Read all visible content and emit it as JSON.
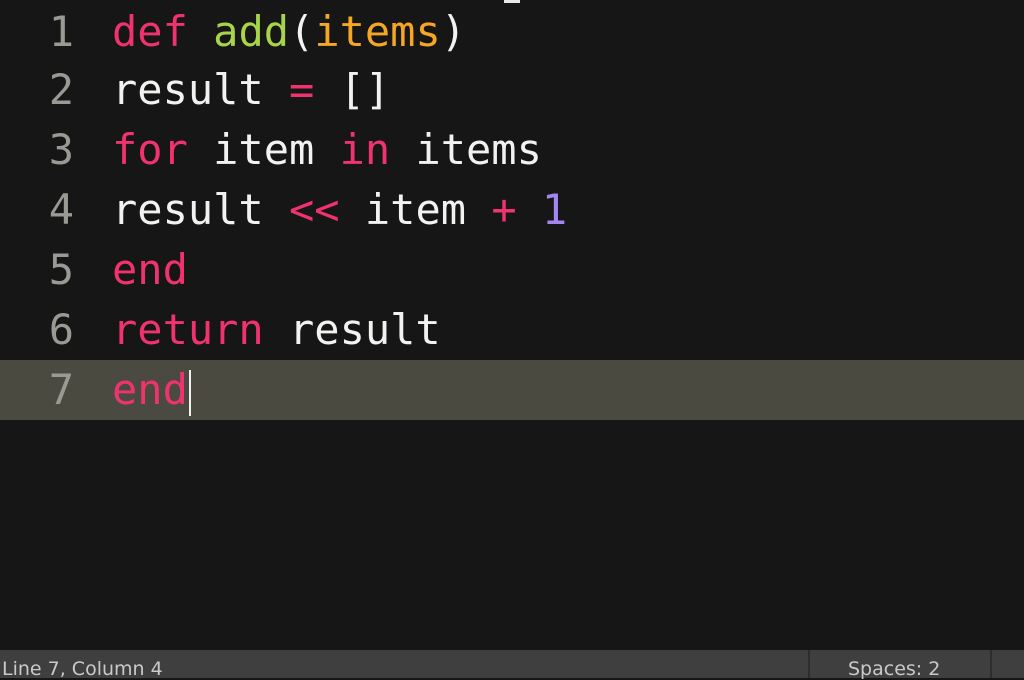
{
  "colors": {
    "background": "#161616",
    "current_line": "#4b4a40",
    "gutter": "#9a9a94",
    "plain": "#f2f2f0",
    "keyword": "#f0336f",
    "function": "#a8d44a",
    "parameter": "#f5a623",
    "number": "#a585f0",
    "statusbar": "#3f3f3f"
  },
  "editor": {
    "current_line_index": 6,
    "lines": [
      {
        "number": "1",
        "tokens": [
          {
            "text": "def",
            "kind": "keyword"
          },
          {
            "text": " ",
            "kind": "plain"
          },
          {
            "text": "add",
            "kind": "function"
          },
          {
            "text": "(",
            "kind": "plain"
          },
          {
            "text": "items",
            "kind": "parameter"
          },
          {
            "text": ")",
            "kind": "plain"
          }
        ]
      },
      {
        "number": "2",
        "tokens": [
          {
            "text": "result",
            "kind": "plain"
          },
          {
            "text": " ",
            "kind": "plain"
          },
          {
            "text": "=",
            "kind": "keyword"
          },
          {
            "text": " ",
            "kind": "plain"
          },
          {
            "text": "[]",
            "kind": "plain"
          }
        ]
      },
      {
        "number": "3",
        "tokens": [
          {
            "text": "for",
            "kind": "keyword"
          },
          {
            "text": " item ",
            "kind": "plain"
          },
          {
            "text": "in",
            "kind": "keyword"
          },
          {
            "text": " items",
            "kind": "plain"
          }
        ]
      },
      {
        "number": "4",
        "tokens": [
          {
            "text": "result",
            "kind": "plain"
          },
          {
            "text": " ",
            "kind": "plain"
          },
          {
            "text": "<<",
            "kind": "keyword"
          },
          {
            "text": " item ",
            "kind": "plain"
          },
          {
            "text": "+",
            "kind": "keyword"
          },
          {
            "text": " ",
            "kind": "plain"
          },
          {
            "text": "1",
            "kind": "number"
          }
        ]
      },
      {
        "number": "5",
        "tokens": [
          {
            "text": "end",
            "kind": "keyword"
          }
        ]
      },
      {
        "number": "6",
        "tokens": [
          {
            "text": "return",
            "kind": "keyword"
          },
          {
            "text": " result",
            "kind": "plain"
          }
        ]
      },
      {
        "number": "7",
        "tokens": [
          {
            "text": "end",
            "kind": "keyword"
          }
        ]
      }
    ]
  },
  "statusbar": {
    "cursor_position": "Line 7, Column 4",
    "indentation": "Spaces: 2"
  }
}
